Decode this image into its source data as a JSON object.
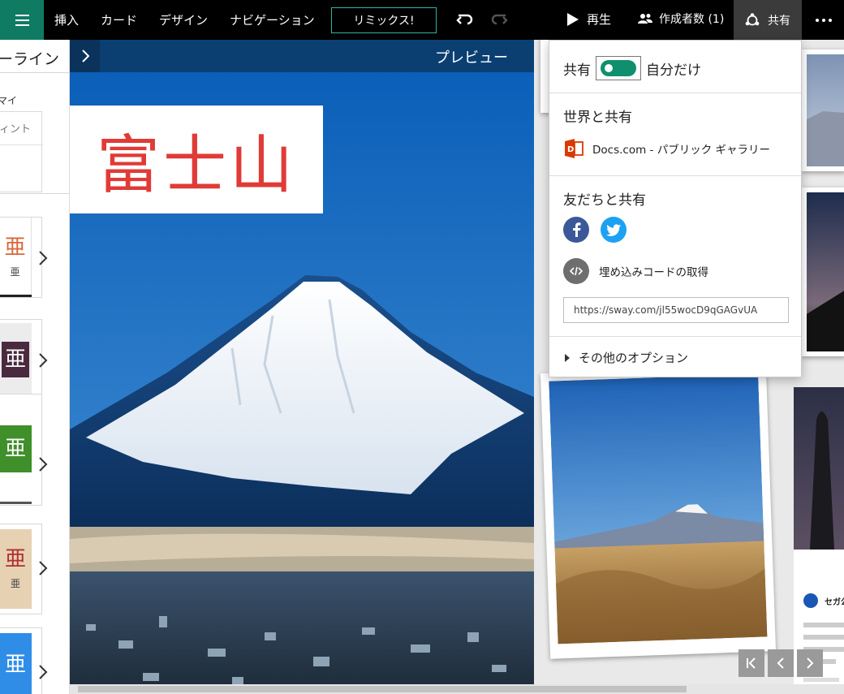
{
  "toolbar": {
    "menu": [
      "挿入",
      "カード",
      "デザイン",
      "ナビゲーション"
    ],
    "remix_label": "リミックス!",
    "play_label": "再生",
    "authors_label": "作成者数 (1)",
    "share_label": "共有"
  },
  "storyline": {
    "title": "ーライン",
    "summary_label": "マイ",
    "summary_placeholder": "ィント",
    "thumbs": [
      {
        "big": "亜",
        "small": "亜"
      },
      {
        "big": "亜"
      },
      {
        "big": "亜"
      },
      {
        "big": "亜",
        "small": "亜"
      },
      {
        "big": "亜"
      }
    ]
  },
  "preview": {
    "label": "プレビュー",
    "title": "富士山",
    "tweet_name": "セガ公"
  },
  "share_panel": {
    "share_prefix": "共有",
    "share_suffix": "自分だけ",
    "world_title": "世界と共有",
    "docs_label": "Docs.com - パブリック ギャラリー",
    "friends_title": "友だちと共有",
    "embed_label": "埋め込みコードの取得",
    "url": "https://sway.com/jl55wocD9qGAGvUA",
    "more_options": "その他のオプション"
  },
  "colors": {
    "accent_green": "#0f7b63",
    "toggle_green": "#0f8f6d",
    "header_blue": "#0b3f72",
    "title_red": "#e03b37",
    "facebook": "#3b5998",
    "twitter": "#1da1f2",
    "office": "#d83b01"
  }
}
